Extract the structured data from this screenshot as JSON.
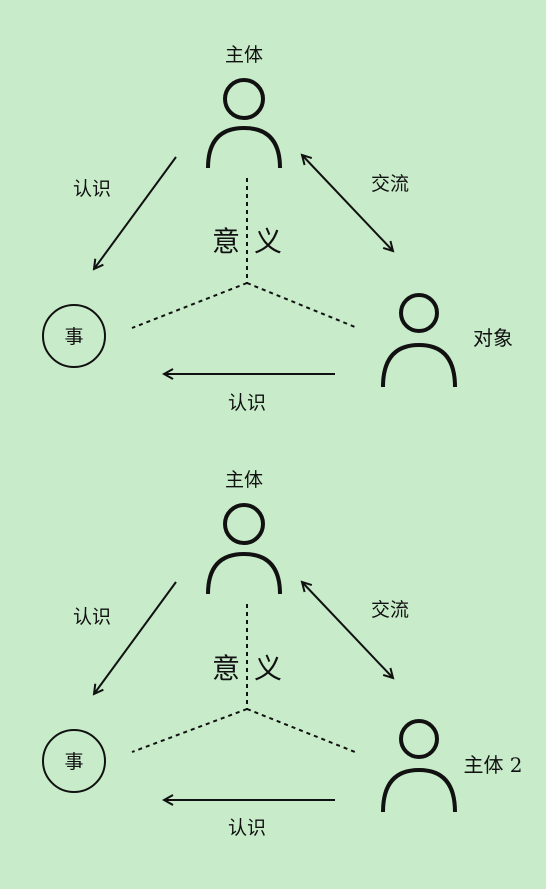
{
  "colors": {
    "background": "#c8ebc9",
    "ink": "#111111"
  },
  "diagrams": [
    {
      "subject_label": "主体",
      "know_left_label": "认识",
      "exchange_label": "交流",
      "meaning_char_1": "意",
      "meaning_char_2": "义",
      "thing_label": "事",
      "other_label": "对象",
      "know_bottom_label": "认识"
    },
    {
      "subject_label": "主体",
      "know_left_label": "认识",
      "exchange_label": "交流",
      "meaning_char_1": "意",
      "meaning_char_2": "义",
      "thing_label": "事",
      "other_label": "主体 2",
      "know_bottom_label": "认识"
    }
  ]
}
